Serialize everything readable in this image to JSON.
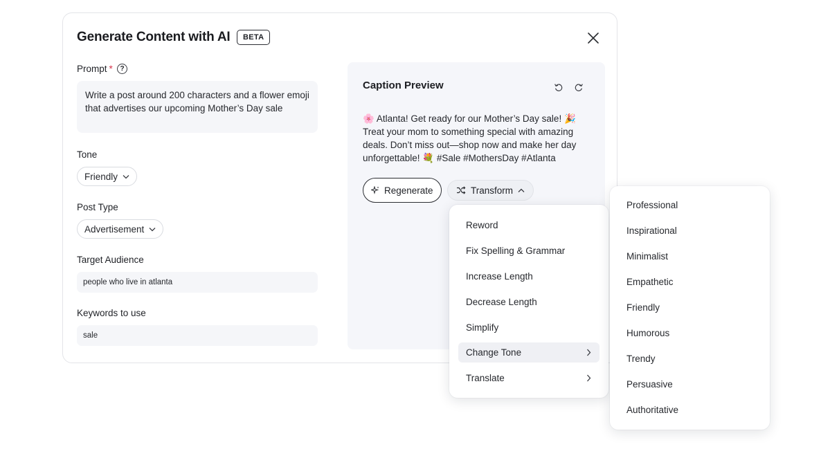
{
  "modal": {
    "title": "Generate Content with AI",
    "badge": "BETA"
  },
  "form": {
    "prompt_label": "Prompt",
    "required_mark": "*",
    "help_icon": "?",
    "prompt_value": "Write a post around 200 characters and a flower emoji that advertises our upcoming Mother’s Day sale",
    "tone_label": "Tone",
    "tone_value": "Friendly",
    "post_type_label": "Post Type",
    "post_type_value": "Advertisement",
    "audience_label": "Target Audience",
    "audience_value": "people who live in atlanta",
    "keywords_label": "Keywords to use",
    "keywords_value": "sale"
  },
  "preview": {
    "title": "Caption Preview",
    "caption": "🌸 Atlanta! Get ready for our Mother’s Day sale! 🎉 Treat your mom to something special with amazing deals. Don’t miss out—shop now and make her day unforgettable! 💐 #Sale #MothersDay #Atlanta",
    "regenerate_label": "Regenerate",
    "transform_label": "Transform"
  },
  "transform_menu": {
    "items": [
      {
        "label": "Reword"
      },
      {
        "label": "Fix Spelling & Grammar"
      },
      {
        "label": "Increase Length"
      },
      {
        "label": "Decrease Length"
      },
      {
        "label": "Simplify"
      },
      {
        "label": "Change Tone"
      },
      {
        "label": "Translate"
      }
    ]
  },
  "tone_menu": {
    "items": [
      {
        "label": "Professional"
      },
      {
        "label": "Inspirational"
      },
      {
        "label": "Minimalist"
      },
      {
        "label": "Empathetic"
      },
      {
        "label": "Friendly"
      },
      {
        "label": "Humorous"
      },
      {
        "label": "Trendy"
      },
      {
        "label": "Persuasive"
      },
      {
        "label": "Authoritative"
      }
    ]
  },
  "icons": {
    "close": "close-icon",
    "help": "help-circle-icon",
    "undo": "undo-icon",
    "redo": "redo-icon",
    "sparkle": "sparkle-icon",
    "shuffle": "shuffle-icon",
    "chevron_down": "chevron-down-icon",
    "chevron_up": "chevron-up-icon",
    "chevron_right": "chevron-right-icon"
  },
  "colors": {
    "accent_required": "#d6334a",
    "panel_bg": "#f5f6fa",
    "menu_active_bg": "#eff0f4"
  }
}
